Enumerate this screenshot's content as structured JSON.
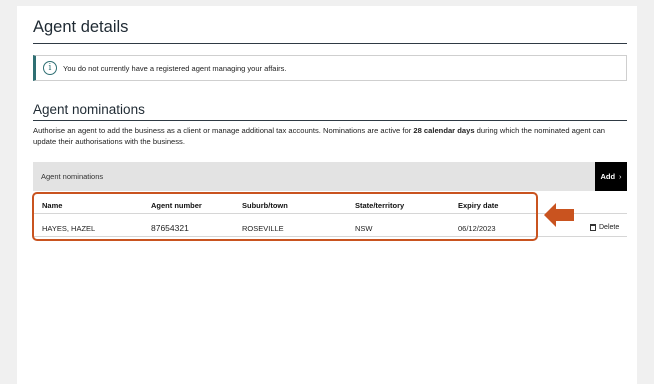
{
  "page": {
    "title": "Agent details",
    "info_message": "You do not currently have a registered agent managing your affairs.",
    "nominations_heading": "Agent nominations",
    "description_part1": "Authorise an agent to add the business as a client or manage additional tax accounts. Nominations are active for ",
    "description_bold": "28 calendar days",
    "description_part2": " during which the nominated agent can update their authorisations with the business.",
    "table_caption": "Agent nominations",
    "add_label": "Add",
    "add_chevron": "›"
  },
  "table": {
    "headers": [
      "Name",
      "Agent number",
      "Suburb/town",
      "State/territory",
      "Expiry date"
    ],
    "rows": [
      [
        "HAYES, HAZEL",
        "87654321",
        "ROSEVILLE",
        "NSW",
        "06/12/2023"
      ]
    ],
    "delete_label": "Delete"
  },
  "colors": {
    "highlight": "#c9531f",
    "info_accent": "#2f6f73",
    "add_button": "#000000"
  },
  "icons": {
    "info": "info-icon",
    "delete": "trash-icon",
    "pointer": "arrow-left-icon",
    "add": "chevron-right-icon"
  }
}
